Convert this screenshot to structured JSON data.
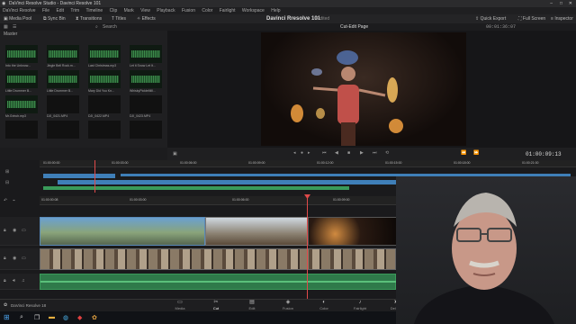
{
  "app": {
    "window_title": "DaVinci Resolve Studio - Davinci Resolve 101",
    "project_title": "Davinci Rresolve 101",
    "project_status": "Edited"
  },
  "menu": [
    "DaVinci Resolve",
    "File",
    "Edit",
    "Trim",
    "Timeline",
    "Clip",
    "Mark",
    "View",
    "Playback",
    "Fusion",
    "Color",
    "Fairlight",
    "Workspace",
    "Help"
  ],
  "toolbar": {
    "media_pool": "Media Pool",
    "sync_bin": "Sync Bin",
    "transitions": "Transitions",
    "titles": "Titles",
    "effects": "Effects",
    "quick_export": "Quick Export",
    "full_screen": "Full Screen",
    "inspector": "Inspector"
  },
  "pathbar": {
    "bin": "Master",
    "search": "Search",
    "page_label": "Cut-Edit Page",
    "timecode_top": "00:01:36:07"
  },
  "media_clips": [
    {
      "label": "Into the Unknow...",
      "kind": "audio"
    },
    {
      "label": "Jingle Bell Rock.m...",
      "kind": "audio"
    },
    {
      "label": "Last Christmas.mp3",
      "kind": "audio"
    },
    {
      "label": "Let it Snow Let It...",
      "kind": "audio"
    },
    {
      "label": "Little Drummer B...",
      "kind": "audio"
    },
    {
      "label": "Little Drummer B...",
      "kind": "audio"
    },
    {
      "label": "Mary Did You Kn...",
      "kind": "audio"
    },
    {
      "label": "WhiskyPickleMill...",
      "kind": "audio"
    },
    {
      "label": "Mr.Grinch.mp3",
      "kind": "audio"
    },
    {
      "label": "DJI_0421.MP4",
      "kind": "video"
    },
    {
      "label": "DJI_0422.MP4",
      "kind": "video"
    },
    {
      "label": "DJI_0423.MP4",
      "kind": "video"
    },
    {
      "label": "",
      "kind": "video"
    },
    {
      "label": "",
      "kind": "video"
    },
    {
      "label": "",
      "kind": "video"
    },
    {
      "label": "",
      "kind": "video"
    }
  ],
  "viewer": {
    "timecode": "01:00:09:13"
  },
  "ruler_upper": [
    "01:00:00:00",
    "01:00:03:00",
    "01:00:06:00",
    "01:00:09:00",
    "01:00:12:00",
    "01:00:15:00",
    "01:00:18:00",
    "01:00:21:00"
  ],
  "ruler_lower": [
    "01:00:00:08",
    "01:00:03:00",
    "01:00:06:00",
    "01:00:09:00",
    "01:00:12:00",
    "01:00:15:00",
    "01:00:18:00"
  ],
  "pages": [
    {
      "label": "Media",
      "glyph": "▭"
    },
    {
      "label": "Cut",
      "glyph": "✂"
    },
    {
      "label": "Edit",
      "glyph": "▤"
    },
    {
      "label": "Fusion",
      "glyph": "◈"
    },
    {
      "label": "Color",
      "glyph": "◐"
    },
    {
      "label": "Fairlight",
      "glyph": "♪"
    },
    {
      "label": "Deliver",
      "glyph": "➤"
    }
  ],
  "footer": {
    "app_label": "DaVinci Resolve 18"
  },
  "colors": {
    "playhead": "#e04a4a",
    "blue_clip": "#3f7fb8",
    "green_clip": "#3a9a5a",
    "accent": "#e04040"
  }
}
